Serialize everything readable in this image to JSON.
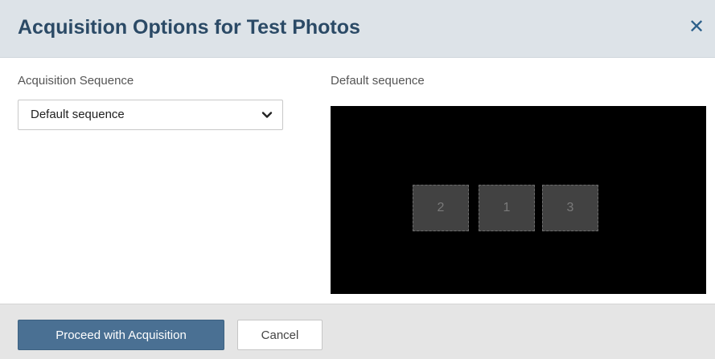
{
  "dialog": {
    "title": "Acquisition Options for Test Photos",
    "close_icon": "close-icon",
    "sequence_label": "Acquisition Sequence",
    "sequence_select": {
      "selected": "Default sequence",
      "icon": "chevron-down-icon"
    },
    "preview": {
      "label": "Default sequence",
      "tiles": [
        "2",
        "1",
        "3"
      ]
    },
    "footer": {
      "proceed_label": "Proceed with Acquisition",
      "cancel_label": "Cancel"
    },
    "colors": {
      "header_bg": "#dde3e8",
      "title": "#2b4a66",
      "primary_button": "#4a7093",
      "preview_bg": "#000000"
    }
  }
}
